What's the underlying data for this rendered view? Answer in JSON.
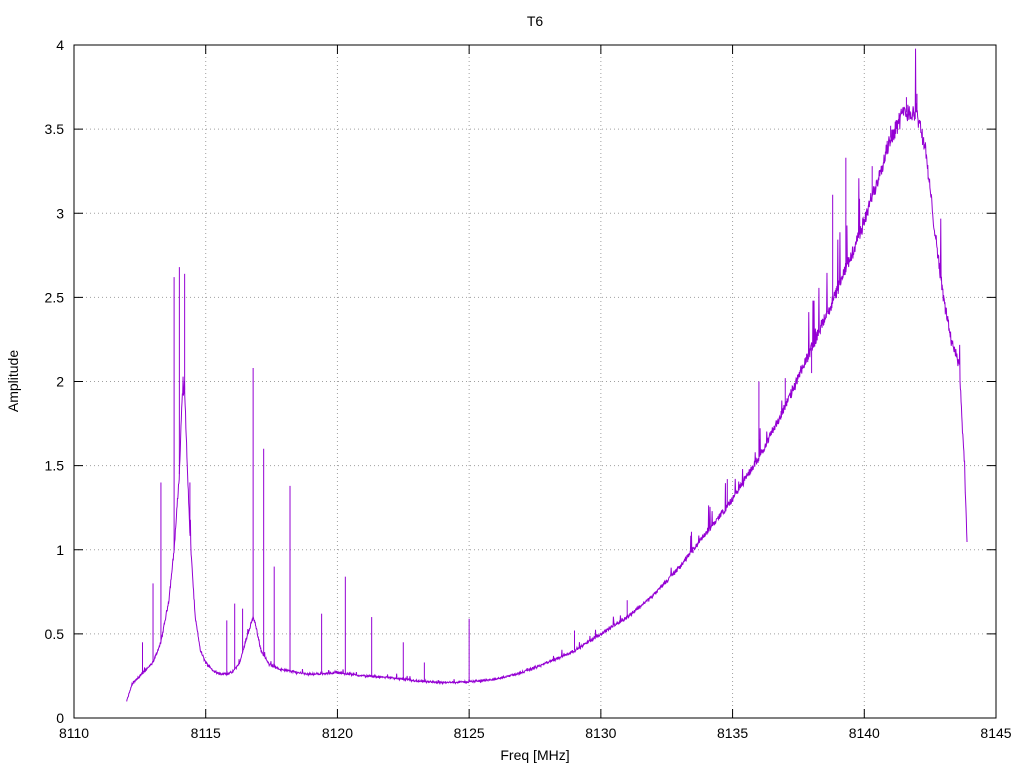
{
  "chart_data": {
    "type": "line",
    "title": "T6",
    "xlabel": "Freq [MHz]",
    "ylabel": "Amplitude",
    "xlim": [
      8110,
      8145
    ],
    "ylim": [
      0,
      4
    ],
    "xticks": [
      8110,
      8115,
      8120,
      8125,
      8130,
      8135,
      8140,
      8145
    ],
    "yticks": [
      0,
      0.5,
      1,
      1.5,
      2,
      2.5,
      3,
      3.5,
      4
    ],
    "ytick_labels": [
      "0",
      "0.5",
      "1",
      "1.5",
      "2",
      "2.5",
      "3",
      "3.5",
      "4"
    ],
    "grid": true,
    "legend": "none",
    "series_color": "#9400d3",
    "series": [
      {
        "x": [
          8112.0,
          8112.2,
          8112.5,
          8113.0,
          8113.3,
          8113.6,
          8113.8,
          8114.0,
          8114.1,
          8114.2,
          8114.3,
          8114.4,
          8114.6,
          8114.8,
          8115.0,
          8115.3,
          8115.6,
          8116.0,
          8116.3,
          8116.5,
          8116.7,
          8116.8,
          8116.9,
          8117.1,
          8117.4,
          8117.8,
          8118.5,
          8119.0,
          8120.0,
          8120.5,
          8121.0,
          8122.0,
          8123.0,
          8124.0,
          8125.0,
          8126.0,
          8127.0,
          8128.0,
          8129.0,
          8130.0,
          8131.0,
          8132.0,
          8133.0,
          8134.0,
          8135.0,
          8136.0,
          8137.0,
          8138.0,
          8139.0,
          8140.0,
          8140.5,
          8141.0,
          8141.5,
          8142.0,
          8142.3,
          8142.6,
          8143.0,
          8143.3,
          8143.6,
          8143.8,
          8143.9
        ],
        "y": [
          0.1,
          0.2,
          0.25,
          0.33,
          0.45,
          0.7,
          1.0,
          1.45,
          1.9,
          1.95,
          1.5,
          1.1,
          0.6,
          0.4,
          0.33,
          0.28,
          0.26,
          0.27,
          0.33,
          0.45,
          0.55,
          0.6,
          0.55,
          0.4,
          0.32,
          0.29,
          0.27,
          0.26,
          0.27,
          0.26,
          0.25,
          0.24,
          0.22,
          0.21,
          0.215,
          0.23,
          0.27,
          0.33,
          0.4,
          0.5,
          0.6,
          0.73,
          0.9,
          1.1,
          1.3,
          1.55,
          1.85,
          2.2,
          2.55,
          2.95,
          3.2,
          3.45,
          3.6,
          3.6,
          3.4,
          3.0,
          2.5,
          2.25,
          2.1,
          1.5,
          1.05
        ]
      }
    ],
    "spikes": {
      "x": [
        8112.6,
        8113.0,
        8113.3,
        8113.8,
        8114.0,
        8114.2,
        8114.4,
        8115.8,
        8116.1,
        8116.4,
        8116.8,
        8117.2,
        8117.6,
        8118.2,
        8119.4,
        8120.3,
        8121.3,
        8122.5,
        8123.3,
        8125.0,
        8129.0,
        8131.0,
        8133.5,
        8134.8,
        8136.0,
        8137.0,
        8138.0,
        8138.8,
        8139.3,
        8140.3,
        8141.0,
        8141.6,
        8142.0
      ],
      "y": [
        0.45,
        0.8,
        1.4,
        2.62,
        2.68,
        2.64,
        1.4,
        0.58,
        0.68,
        0.65,
        2.08,
        1.6,
        0.9,
        1.38,
        0.62,
        0.84,
        0.6,
        0.45,
        0.33,
        0.59,
        0.52,
        0.7,
        0.98,
        1.42,
        2.0,
        2.02,
        2.05,
        3.11,
        3.33,
        3.28,
        3.52,
        3.69,
        3.71
      ]
    }
  }
}
